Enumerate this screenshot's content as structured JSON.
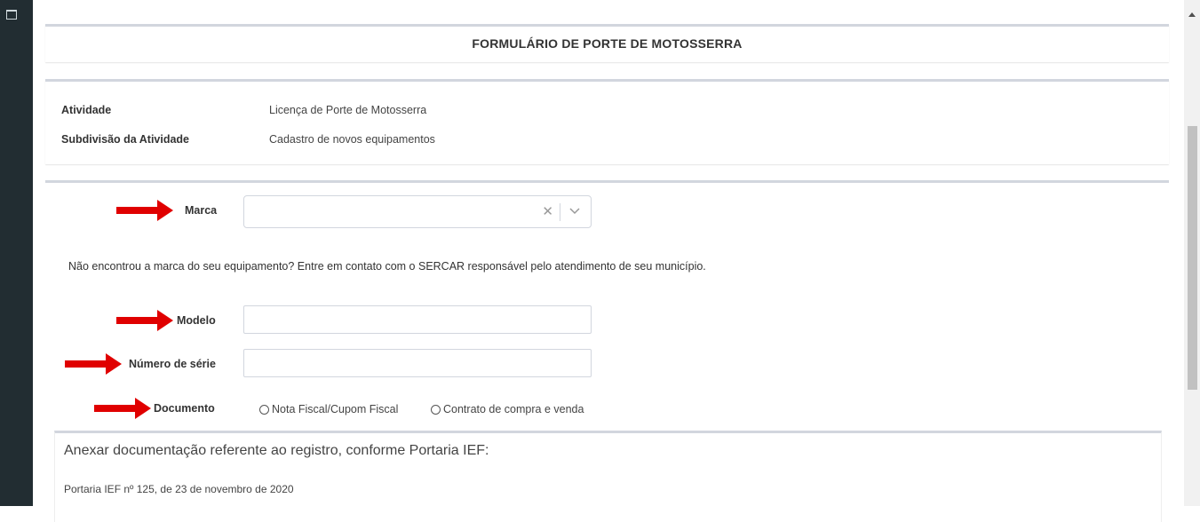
{
  "header": {
    "title": "FORMULÁRIO DE PORTE DE MOTOSSERRA"
  },
  "info": {
    "rows": [
      {
        "key": "Atividade",
        "value": "Licença de Porte de Motosserra"
      },
      {
        "key": "Subdivisão da Atividade",
        "value": "Cadastro de novos equipamentos"
      }
    ]
  },
  "form": {
    "marca_label": "Marca",
    "marca_value": "",
    "help_text": "Não encontrou a marca do seu equipamento? Entre em contato com o SERCAR responsável pelo atendimento de seu município.",
    "modelo_label": "Modelo",
    "modelo_value": "",
    "serie_label": "Número de série",
    "serie_value": "",
    "documento_label": "Documento",
    "documento_options": [
      "Nota Fiscal/Cupom Fiscal",
      "Contrato de compra e venda"
    ]
  },
  "attach": {
    "title": "Anexar documentação referente ao registro, conforme Portaria IEF:",
    "subtitle": "Portaria IEF nº 125, de 23 de novembro de 2020"
  },
  "colors": {
    "arrow": "#e00000",
    "sidebar": "#222d32",
    "panel_border": "#d2d6de"
  },
  "icons": {
    "clear": "close-icon",
    "dropdown": "chevron-down-icon",
    "annotation": "red-arrow-icon"
  }
}
